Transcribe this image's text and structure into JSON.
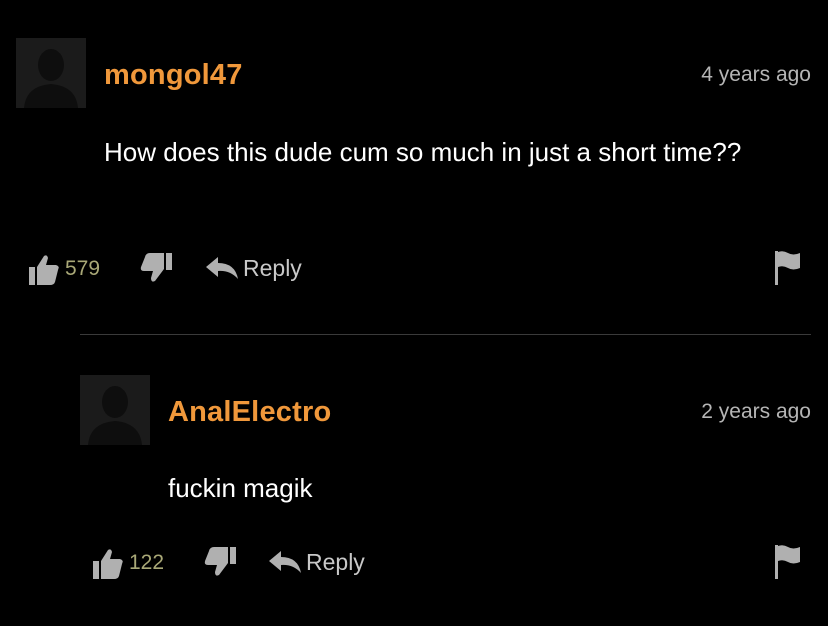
{
  "comments": [
    {
      "username": "mongol47",
      "timestamp": "4 years ago",
      "text": "How does this dude cum so much in just a short time??",
      "likes": "579",
      "reply_label": "Reply"
    },
    {
      "username": "AnalElectro",
      "timestamp": "2 years ago",
      "text": "fuckin magik",
      "likes": "122",
      "reply_label": "Reply"
    }
  ],
  "colors": {
    "background": "#000000",
    "username": "#f0983b",
    "timestamp": "#b5b5b5",
    "like_count": "#a9a877",
    "icon": "#b0b0b0"
  },
  "icons": [
    "avatar-placeholder",
    "thumbs-up-icon",
    "thumbs-down-icon",
    "reply-arrow-icon",
    "flag-icon"
  ]
}
